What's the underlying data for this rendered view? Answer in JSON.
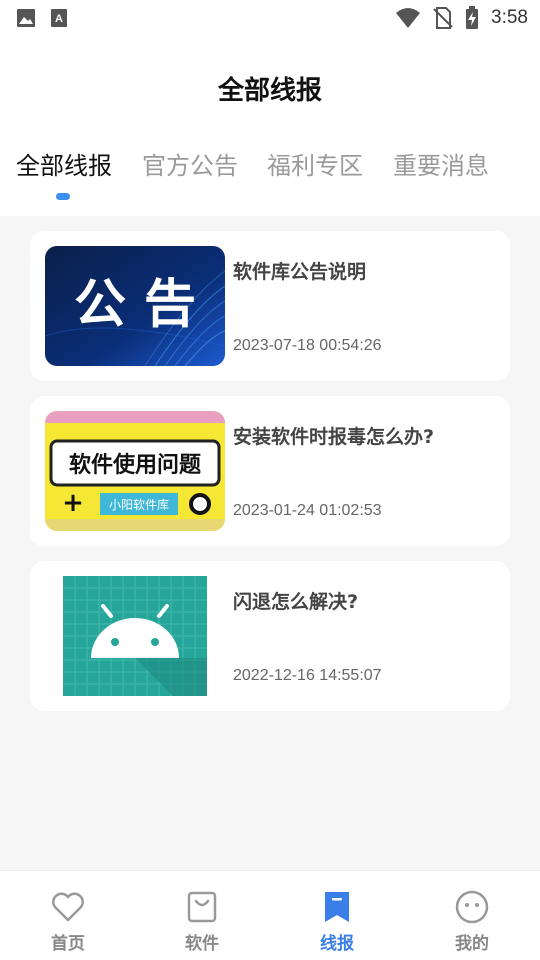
{
  "status_bar": {
    "time": "3:58",
    "icons": [
      "image-icon",
      "text-a-icon",
      "wifi-icon",
      "no-sim-icon",
      "battery-charging-icon"
    ]
  },
  "header": {
    "title": "全部线报"
  },
  "tabs": [
    {
      "label": "全部线报",
      "active": true
    },
    {
      "label": "官方公告",
      "active": false
    },
    {
      "label": "福利专区",
      "active": false
    },
    {
      "label": "重要消息",
      "active": false
    }
  ],
  "cards": [
    {
      "title": "软件库公告说明",
      "date": "2023-07-18 00:54:26",
      "thumb_text": "公 告",
      "thumb_icon": "announcement-banner"
    },
    {
      "title": "安装软件时报毒怎么办?",
      "date": "2023-01-24 01:02:53",
      "thumb_text": "软件使用问题",
      "thumb_subtext": "小阳软件库",
      "thumb_icon": "software-usage-banner"
    },
    {
      "title": "闪退怎么解决?",
      "date": "2022-12-16 14:55:07",
      "thumb_icon": "android-logo"
    }
  ],
  "bottom_nav": [
    {
      "label": "首页",
      "icon": "heart-icon",
      "active": false
    },
    {
      "label": "软件",
      "icon": "shopping-bag-icon",
      "active": false
    },
    {
      "label": "线报",
      "icon": "bookmark-icon",
      "active": true
    },
    {
      "label": "我的",
      "icon": "smiley-face-icon",
      "active": false
    }
  ],
  "colors": {
    "accent": "#3a8ff0",
    "nav_active": "#3a7ee8",
    "background": "#f6f6f6"
  }
}
